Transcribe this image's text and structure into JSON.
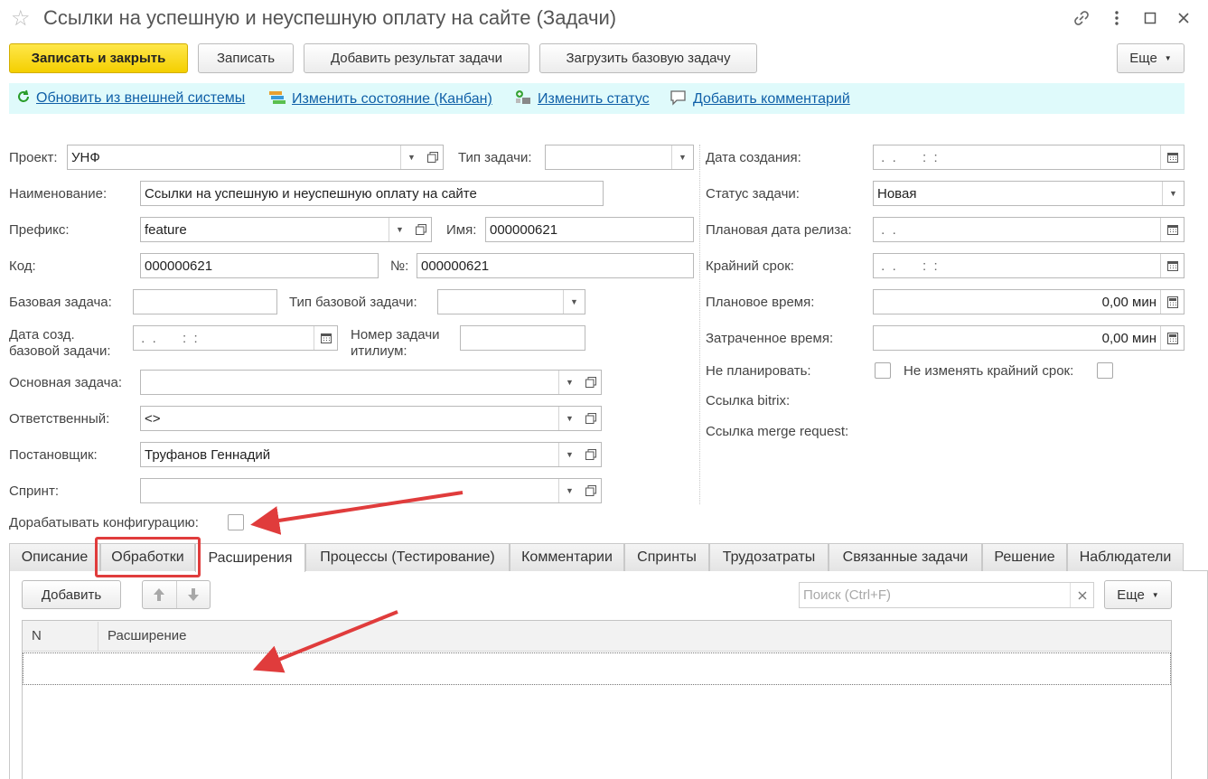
{
  "window": {
    "title": "Ссылки на успешную и неуспешную оплату на сайте (Задачи)"
  },
  "toolbar": {
    "save_close": "Записать и закрыть",
    "save": "Записать",
    "add_result": "Добавить результат задачи",
    "load_base": "Загрузить базовую задачу",
    "more": "Еще"
  },
  "commands": {
    "refresh": "Обновить из внешней системы",
    "kanban": "Изменить состояние (Канбан)",
    "status": "Изменить статус",
    "comment": "Добавить комментарий"
  },
  "form": {
    "project_label": "Проект:",
    "project_value": "УНФ",
    "task_type_label": "Тип задачи:",
    "task_type_value": "",
    "name_label": "Наименование:",
    "name_value": "Ссылки на успешную и неуспешную оплату на сайте",
    "prefix_label": "Префикс:",
    "prefix_value": "feature",
    "imya_label": "Имя:",
    "imya_value": "000000621",
    "code_label": "Код:",
    "code_value": "000000621",
    "number_label": "№:",
    "number_value": "000000621",
    "base_task_label": "Базовая задача:",
    "base_task_value": "",
    "base_type_label": "Тип базовой задачи:",
    "base_date_label_1": "Дата созд.",
    "base_date_label_2": "базовой задачи:",
    "base_date_value": " .  .       :  :",
    "itilium_label_1": "Номер задачи",
    "itilium_label_2": "итилиум:",
    "main_task_label": "Основная задача:",
    "responsible_label": "Ответственный:",
    "responsible_value": "<>",
    "author_label": "Постановщик:",
    "author_value": "Труфанов Геннадий",
    "sprint_label": "Спринт:",
    "modify_config_label": "Дорабатывать конфигурацию:",
    "created_label": "Дата создания:",
    "created_value": " .  .       :  :",
    "status_label": "Статус задачи:",
    "status_value": "Новая",
    "release_label": "Плановая дата релиза:",
    "release_value": " .  .",
    "deadline_label": "Крайний срок:",
    "deadline_value": " .  .       :  :",
    "planned_time_label": "Плановое время:",
    "planned_time_value": "0,00 мин",
    "spent_time_label": "Затраченное время:",
    "spent_time_value": "0,00 мин",
    "no_plan_label": "Не планировать:",
    "no_change_deadline_label": "Не изменять крайний срок:",
    "bitrix_label": "Ссылка bitrix:",
    "merge_label": "Ссылка merge request:"
  },
  "tabs": [
    {
      "label": "Описание"
    },
    {
      "label": "Обработки"
    },
    {
      "label": "Расширения"
    },
    {
      "label": "Процессы (Тестирование)"
    },
    {
      "label": "Комментарии"
    },
    {
      "label": "Спринты"
    },
    {
      "label": "Трудозатраты"
    },
    {
      "label": "Связанные задачи"
    },
    {
      "label": "Решение"
    },
    {
      "label": "Наблюдатели"
    }
  ],
  "table": {
    "add_button": "Добавить",
    "search_placeholder": "Поиск (Ctrl+F)",
    "more": "Еще",
    "col_n": "N",
    "col_ext": "Расширение"
  },
  "colors": {
    "primary_button": "#f4cf00",
    "command_bar": "#dffafb",
    "link": "#1060a8",
    "annotation": "#e03c3c"
  }
}
